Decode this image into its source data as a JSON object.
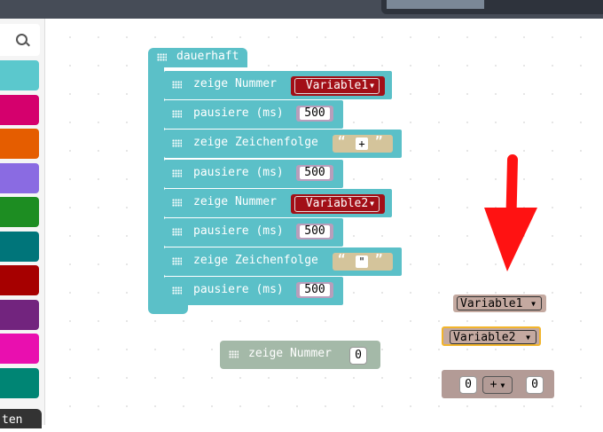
{
  "toolbox": {
    "categories": [
      "#5bc8cd",
      "#d5006d",
      "#e55d00",
      "#8a6be2",
      "#1d8d22",
      "#00757a",
      "#a60000",
      "#72247e",
      "#e90faf",
      "#008574"
    ],
    "bottom_tab_label": "ten"
  },
  "program": {
    "hat_label": "dauerhaft",
    "rows": [
      {
        "kind": "show_number",
        "label": "zeige Nummer",
        "value": "Variable1"
      },
      {
        "kind": "pause",
        "label": "pausiere (ms)",
        "value": "500"
      },
      {
        "kind": "show_string",
        "label": "zeige Zeichenfolge",
        "value": "+"
      },
      {
        "kind": "pause",
        "label": "pausiere (ms)",
        "value": "500"
      },
      {
        "kind": "show_number",
        "label": "zeige Nummer",
        "value": "Variable2"
      },
      {
        "kind": "pause",
        "label": "pausiere (ms)",
        "value": "500"
      },
      {
        "kind": "show_string",
        "label": "zeige Zeichenfolge",
        "value": "\""
      },
      {
        "kind": "pause",
        "label": "pausiere (ms)",
        "value": "500"
      }
    ]
  },
  "loose_blocks": {
    "ghost_label": "zeige Nummer",
    "ghost_value": "0",
    "var1": "Variable1",
    "var2": "Variable2",
    "math_left": "0",
    "math_op": "+",
    "math_right": "0"
  },
  "arrow_color": "#ff1212"
}
